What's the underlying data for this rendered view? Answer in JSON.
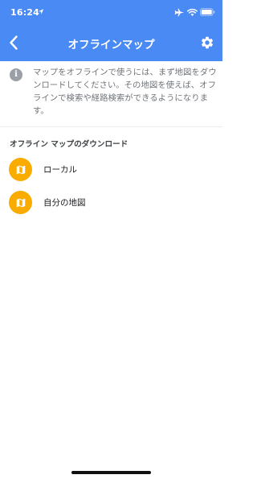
{
  "status_bar": {
    "time": "16:24"
  },
  "nav": {
    "title": "オフラインマップ",
    "back_icon": "chevron-left-icon",
    "settings_icon": "gear-icon"
  },
  "info": {
    "icon": "info-icon",
    "icon_glyph": "i",
    "text": "マップをオフラインで使うには、まず地図をダウンロードしてください。その地図を使えば、オフラインで検索や経路検索ができるようになります。"
  },
  "section": {
    "header": "オフライン マップのダウンロード"
  },
  "items": [
    {
      "label": "ローカル",
      "icon": "map-icon"
    },
    {
      "label": "自分の地図",
      "icon": "map-icon"
    }
  ],
  "colors": {
    "header_bg": "#4a8af4",
    "item_icon_bg": "#f9ab00",
    "info_icon_bg": "#9aa0a6"
  }
}
